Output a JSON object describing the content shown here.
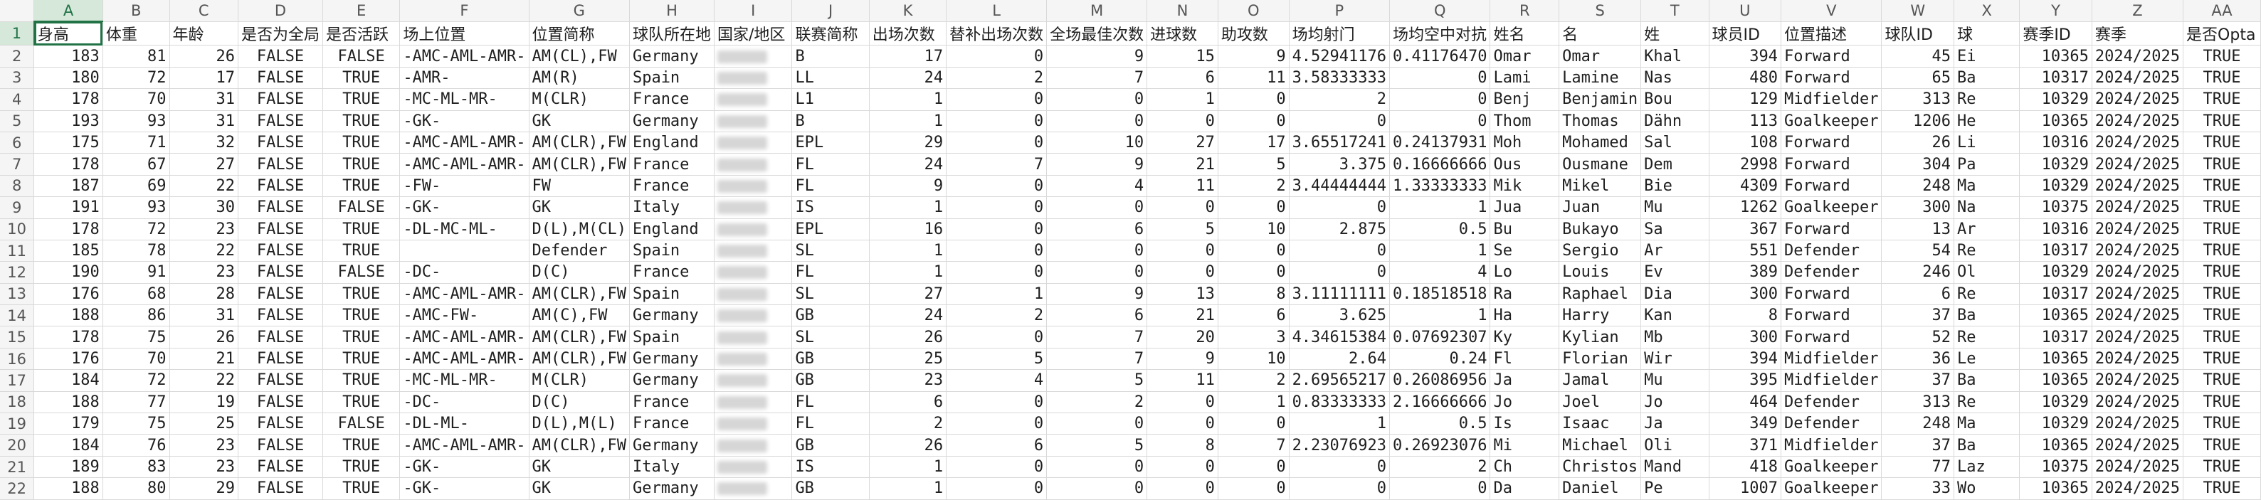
{
  "columns": [
    "A",
    "B",
    "C",
    "D",
    "E",
    "F",
    "G",
    "H",
    "I",
    "J",
    "K",
    "L",
    "M",
    "N",
    "O",
    "P",
    "Q",
    "R",
    "S",
    "T",
    "U",
    "V",
    "W",
    "X",
    "Y",
    "Z",
    "AA"
  ],
  "selected_column": "A",
  "selected_row": "1",
  "rows": [
    [
      "身高",
      "体重",
      "年龄",
      "是否为全局",
      "是否活跃",
      "场上位置",
      "位置简称",
      "球队所在地",
      "国家/地区",
      "联赛简称",
      "出场次数",
      "替补出场次数",
      "全场最佳次数",
      "进球数",
      "助攻数",
      "场均射门",
      "场均空中对抗",
      "姓名",
      "名",
      "姓",
      "球员ID",
      "位置描述",
      "球队ID",
      "球",
      "赛季ID",
      "赛季",
      "是否Opta"
    ],
    [
      "183",
      "81",
      "26",
      "FALSE",
      "FALSE",
      "-AMC-AML-AMR-",
      "AM(CL),FW",
      "Germany",
      "",
      "B",
      "17",
      "0",
      "9",
      "15",
      "9",
      "4.52941176",
      "0.41176470",
      "Omar",
      "Omar",
      "Khal",
      "394",
      "Forward",
      "45",
      "Ei",
      "10365",
      "2024/2025",
      "TRUE"
    ],
    [
      "180",
      "72",
      "17",
      "FALSE",
      "TRUE",
      "-AMR-",
      "AM(R)",
      "Spain",
      "",
      "LL",
      "24",
      "2",
      "7",
      "6",
      "11",
      "3.58333333",
      "0",
      "Lami",
      "Lamine",
      "Nas",
      "480",
      "Forward",
      "65",
      "Ba",
      "10317",
      "2024/2025",
      "TRUE"
    ],
    [
      "178",
      "70",
      "31",
      "FALSE",
      "TRUE",
      "-MC-ML-MR-",
      "M(CLR)",
      "France",
      "",
      "L1",
      "1",
      "0",
      "0",
      "1",
      "0",
      "2",
      "0",
      "Benj",
      "Benjamin",
      "Bou",
      "129",
      "Midfielder",
      "313",
      "Re",
      "10329",
      "2024/2025",
      "TRUE"
    ],
    [
      "193",
      "93",
      "31",
      "FALSE",
      "TRUE",
      "-GK-",
      "GK",
      "Germany",
      "",
      "B",
      "1",
      "0",
      "0",
      "0",
      "0",
      "0",
      "0",
      "Thom",
      "Thomas",
      "Dähn",
      "113",
      "Goalkeeper",
      "1206",
      "He",
      "10365",
      "2024/2025",
      "TRUE"
    ],
    [
      "175",
      "71",
      "32",
      "FALSE",
      "TRUE",
      "-AMC-AML-AMR-",
      "AM(CLR),FW",
      "England",
      "",
      "EPL",
      "29",
      "0",
      "10",
      "27",
      "17",
      "3.65517241",
      "0.24137931",
      "Moh",
      "Mohamed",
      "Sal",
      "108",
      "Forward",
      "26",
      "Li",
      "10316",
      "2024/2025",
      "TRUE"
    ],
    [
      "178",
      "67",
      "27",
      "FALSE",
      "TRUE",
      "-AMC-AML-AMR-",
      "AM(CLR),FW",
      "France",
      "",
      "FL",
      "24",
      "7",
      "9",
      "21",
      "5",
      "3.375",
      "0.16666666",
      "Ous",
      "Ousmane",
      "Dem",
      "2998",
      "Forward",
      "304",
      "Pa",
      "10329",
      "2024/2025",
      "TRUE"
    ],
    [
      "187",
      "69",
      "22",
      "FALSE",
      "TRUE",
      "-FW-",
      "FW",
      "France",
      "",
      "FL",
      "9",
      "0",
      "4",
      "11",
      "2",
      "3.44444444",
      "1.33333333",
      "Mik",
      "Mikel",
      "Bie",
      "4309",
      "Forward",
      "248",
      "Ma",
      "10329",
      "2024/2025",
      "TRUE"
    ],
    [
      "191",
      "93",
      "30",
      "FALSE",
      "FALSE",
      "-GK-",
      "GK",
      "Italy",
      "",
      "IS",
      "1",
      "0",
      "0",
      "0",
      "0",
      "0",
      "1",
      "Jua",
      "Juan",
      "Mu",
      "1262",
      "Goalkeeper",
      "300",
      "Na",
      "10375",
      "2024/2025",
      "TRUE"
    ],
    [
      "178",
      "72",
      "23",
      "FALSE",
      "TRUE",
      "-DL-MC-ML-",
      "D(L),M(CL)",
      "England",
      "",
      "EPL",
      "16",
      "0",
      "6",
      "5",
      "10",
      "2.875",
      "0.5",
      "Bu",
      "Bukayo",
      "Sa",
      "367",
      "Forward",
      "13",
      "Ar",
      "10316",
      "2024/2025",
      "TRUE"
    ],
    [
      "185",
      "78",
      "22",
      "FALSE",
      "TRUE",
      "",
      "Defender",
      "Spain",
      "",
      "SL",
      "1",
      "0",
      "0",
      "0",
      "0",
      "0",
      "1",
      "Se",
      "Sergio",
      "Ar",
      "551",
      "Defender",
      "54",
      "Re",
      "10317",
      "2024/2025",
      "TRUE"
    ],
    [
      "190",
      "91",
      "23",
      "FALSE",
      "FALSE",
      "-DC-",
      "D(C)",
      "France",
      "",
      "FL",
      "1",
      "0",
      "0",
      "0",
      "0",
      "0",
      "4",
      "Lo",
      "Louis",
      "Ev",
      "389",
      "Defender",
      "246",
      "Ol",
      "10329",
      "2024/2025",
      "TRUE"
    ],
    [
      "176",
      "68",
      "28",
      "FALSE",
      "TRUE",
      "-AMC-AML-AMR-",
      "AM(CLR),FW",
      "Spain",
      "",
      "SL",
      "27",
      "1",
      "9",
      "13",
      "8",
      "3.11111111",
      "0.18518518",
      "Ra",
      "Raphael",
      "Dia",
      "300",
      "Forward",
      "6",
      "Re",
      "10317",
      "2024/2025",
      "TRUE"
    ],
    [
      "188",
      "86",
      "31",
      "FALSE",
      "TRUE",
      "-AMC-FW-",
      "AM(C),FW",
      "Germany",
      "",
      "GB",
      "24",
      "2",
      "6",
      "21",
      "6",
      "3.625",
      "1",
      "Ha",
      "Harry",
      "Kan",
      "8",
      "Forward",
      "37",
      "Ba",
      "10365",
      "2024/2025",
      "TRUE"
    ],
    [
      "178",
      "75",
      "26",
      "FALSE",
      "TRUE",
      "-AMC-AML-AMR-",
      "AM(CLR),FW",
      "Spain",
      "",
      "SL",
      "26",
      "0",
      "7",
      "20",
      "3",
      "4.34615384",
      "0.07692307",
      "Ky",
      "Kylian",
      "Mb",
      "300",
      "Forward",
      "52",
      "Re",
      "10317",
      "2024/2025",
      "TRUE"
    ],
    [
      "176",
      "70",
      "21",
      "FALSE",
      "TRUE",
      "-AMC-AML-AMR-",
      "AM(CLR),FW",
      "Germany",
      "",
      "GB",
      "25",
      "5",
      "7",
      "9",
      "10",
      "2.64",
      "0.24",
      "Fl",
      "Florian",
      "Wir",
      "394",
      "Midfielder",
      "36",
      "Le",
      "10365",
      "2024/2025",
      "TRUE"
    ],
    [
      "184",
      "72",
      "22",
      "FALSE",
      "TRUE",
      "-MC-ML-MR-",
      "M(CLR)",
      "Germany",
      "",
      "GB",
      "23",
      "4",
      "5",
      "11",
      "2",
      "2.69565217",
      "0.26086956",
      "Ja",
      "Jamal",
      "Mu",
      "395",
      "Midfielder",
      "37",
      "Ba",
      "10365",
      "2024/2025",
      "TRUE"
    ],
    [
      "188",
      "77",
      "19",
      "FALSE",
      "TRUE",
      "-DC-",
      "D(C)",
      "France",
      "",
      "FL",
      "6",
      "0",
      "2",
      "0",
      "1",
      "0.83333333",
      "2.16666666",
      "Jo",
      "Joel",
      "Jo",
      "464",
      "Defender",
      "313",
      "Re",
      "10329",
      "2024/2025",
      "TRUE"
    ],
    [
      "179",
      "75",
      "25",
      "FALSE",
      "FALSE",
      "-DL-ML-",
      "D(L),M(L)",
      "France",
      "",
      "FL",
      "2",
      "0",
      "0",
      "0",
      "0",
      "1",
      "0.5",
      "Is",
      "Isaac",
      "Ja",
      "349",
      "Defender",
      "248",
      "Ma",
      "10329",
      "2024/2025",
      "TRUE"
    ],
    [
      "184",
      "76",
      "23",
      "FALSE",
      "TRUE",
      "-AMC-AML-AMR-",
      "AM(CLR),FW",
      "Germany",
      "",
      "GB",
      "26",
      "6",
      "5",
      "8",
      "7",
      "2.23076923",
      "0.26923076",
      "Mi",
      "Michael",
      "Oli",
      "371",
      "Midfielder",
      "37",
      "Ba",
      "10365",
      "2024/2025",
      "TRUE"
    ],
    [
      "189",
      "83",
      "23",
      "FALSE",
      "TRUE",
      "-GK-",
      "GK",
      "Italy",
      "",
      "IS",
      "1",
      "0",
      "0",
      "0",
      "0",
      "0",
      "2",
      "Ch",
      "Christos",
      "Mand",
      "418",
      "Goalkeeper",
      "77",
      "Laz",
      "10375",
      "2024/2025",
      "TRUE"
    ],
    [
      "188",
      "80",
      "29",
      "FALSE",
      "TRUE",
      "-GK-",
      "GK",
      "Germany",
      "",
      "GB",
      "1",
      "0",
      "0",
      "0",
      "0",
      "0",
      "0",
      "Da",
      "Daniel",
      "Pe",
      "1007",
      "Goalkeeper",
      "33",
      "Wo",
      "10365",
      "2024/2025",
      "TRUE"
    ]
  ],
  "blurred_columns": [
    8,
    20
  ]
}
